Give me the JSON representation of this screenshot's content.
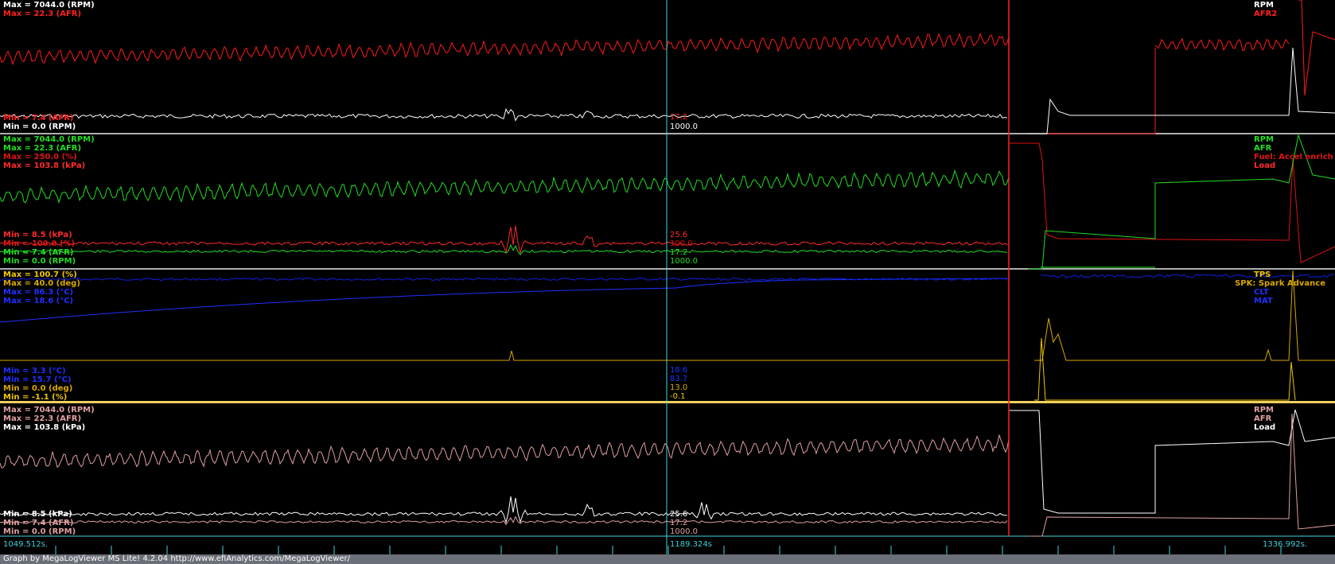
{
  "colors": {
    "rpm_white": "#ffffff",
    "afr_red": "#ff1a1a",
    "afr_green": "#22dd22",
    "fuel_red": "#dd1414",
    "load_red": "#ff2a2a",
    "tps_yellow": "#d8a800",
    "clt_blue": "#2030ff",
    "mat_blue": "#1020e0",
    "pink": "#e0a0a0",
    "cursor_cyan": "#40d8e0",
    "marker_red": "#ff2020",
    "divider": "#e8e8e8"
  },
  "panels": [
    {
      "name": "panel-1",
      "max_labels": [
        {
          "text": "Max = 7044.0 (RPM)",
          "color": "#ffffff"
        },
        {
          "text": "Max = 22.3 (AFR)",
          "color": "#ff2020"
        }
      ],
      "min_labels": [
        {
          "text": "Min = 7.4 (AFR)",
          "color": "#ff2020"
        },
        {
          "text": "Min = 0.0 (RPM)",
          "color": "#ffffff"
        }
      ],
      "legend": [
        {
          "text": "RPM",
          "color": "#ffffff"
        },
        {
          "text": "AFR2",
          "color": "#ff2020"
        }
      ],
      "cursor_values": [
        {
          "text": "17.2",
          "color": "#ff2020"
        },
        {
          "text": "1000.0",
          "color": "#ffffff"
        }
      ]
    },
    {
      "name": "panel-2",
      "max_labels": [
        {
          "text": "Max = 7044.0 (RPM)",
          "color": "#22dd22"
        },
        {
          "text": "Max = 22.3 (AFR)",
          "color": "#22dd22"
        },
        {
          "text": "Max = 250.0 (%)",
          "color": "#dd1414"
        },
        {
          "text": "Max = 103.8 (kPa)",
          "color": "#ff2a2a"
        }
      ],
      "min_labels": [
        {
          "text": "Min = 8.5 (kPa)",
          "color": "#ff2a2a"
        },
        {
          "text": "Min = 100.0 (%)",
          "color": "#dd1414"
        },
        {
          "text": "Min = 7.4 (AFR)",
          "color": "#22dd22"
        },
        {
          "text": "Min = 0.0 (RPM)",
          "color": "#22dd22"
        }
      ],
      "legend": [
        {
          "text": "RPM",
          "color": "#22dd22"
        },
        {
          "text": "AFR",
          "color": "#22dd22"
        },
        {
          "text": "Fuel: Accel enrich",
          "color": "#dd1414"
        },
        {
          "text": "Load",
          "color": "#ff2a2a"
        }
      ],
      "cursor_values": [
        {
          "text": "25.6",
          "color": "#ff2a2a"
        },
        {
          "text": "100.0",
          "color": "#dd1414"
        },
        {
          "text": "17.2",
          "color": "#22dd22"
        },
        {
          "text": "1000.0",
          "color": "#22dd22"
        }
      ]
    },
    {
      "name": "panel-3",
      "max_labels": [
        {
          "text": "Max = 100.7 (%)",
          "color": "#f0c800"
        },
        {
          "text": "Max = 40.0 (deg)",
          "color": "#d8a800"
        },
        {
          "text": "Max = 86.3 (°C)",
          "color": "#2030ff"
        },
        {
          "text": "Max = 18.6 (°C)",
          "color": "#2030ff"
        }
      ],
      "min_labels": [
        {
          "text": "Min = 3.3 (°C)",
          "color": "#2030ff"
        },
        {
          "text": "Min = 15.7 (°C)",
          "color": "#2030ff"
        },
        {
          "text": "Min = 0.0 (deg)",
          "color": "#d8a800"
        },
        {
          "text": "Min = -1.1 (%)",
          "color": "#f0c800"
        }
      ],
      "legend": [
        {
          "text": "TPS",
          "color": "#f0c800"
        },
        {
          "text": "SPK: Spark Advance",
          "color": "#d8a800"
        },
        {
          "text": "CLT",
          "color": "#2030ff"
        },
        {
          "text": "MAT",
          "color": "#2030ff"
        }
      ],
      "cursor_values": [
        {
          "text": "18.6",
          "color": "#2030ff"
        },
        {
          "text": "83.7",
          "color": "#2030ff"
        },
        {
          "text": "13.0",
          "color": "#d8a800"
        },
        {
          "text": "-0.1",
          "color": "#f0c800"
        }
      ]
    },
    {
      "name": "panel-4",
      "max_labels": [
        {
          "text": "Max = 7044.0 (RPM)",
          "color": "#e0a0a0"
        },
        {
          "text": "Max = 22.3 (AFR)",
          "color": "#e0a0a0"
        },
        {
          "text": "Max = 103.8 (kPa)",
          "color": "#ffffff"
        }
      ],
      "min_labels": [
        {
          "text": "Min = 8.5 (kPa)",
          "color": "#ffffff"
        },
        {
          "text": "Min = 7.4 (AFR)",
          "color": "#e0a0a0"
        },
        {
          "text": "Min = 0.0 (RPM)",
          "color": "#e0a0a0"
        }
      ],
      "legend": [
        {
          "text": "RPM",
          "color": "#e0a0a0"
        },
        {
          "text": "AFR",
          "color": "#e0a0a0"
        },
        {
          "text": "Load",
          "color": "#ffffff"
        }
      ],
      "cursor_values": [
        {
          "text": "25.6",
          "color": "#ffffff"
        },
        {
          "text": "17.2",
          "color": "#e0a0a0"
        },
        {
          "text": "1000.0",
          "color": "#e0a0a0"
        }
      ]
    }
  ],
  "timeline": {
    "start": "1049.512s.",
    "cursor": "1189.324s",
    "end": "1336.992s."
  },
  "status_text": "Graph by MegaLogViewer MS Lite! 4.2.04 http://www.efiAnalytics.com/MegaLogViewer/"
}
